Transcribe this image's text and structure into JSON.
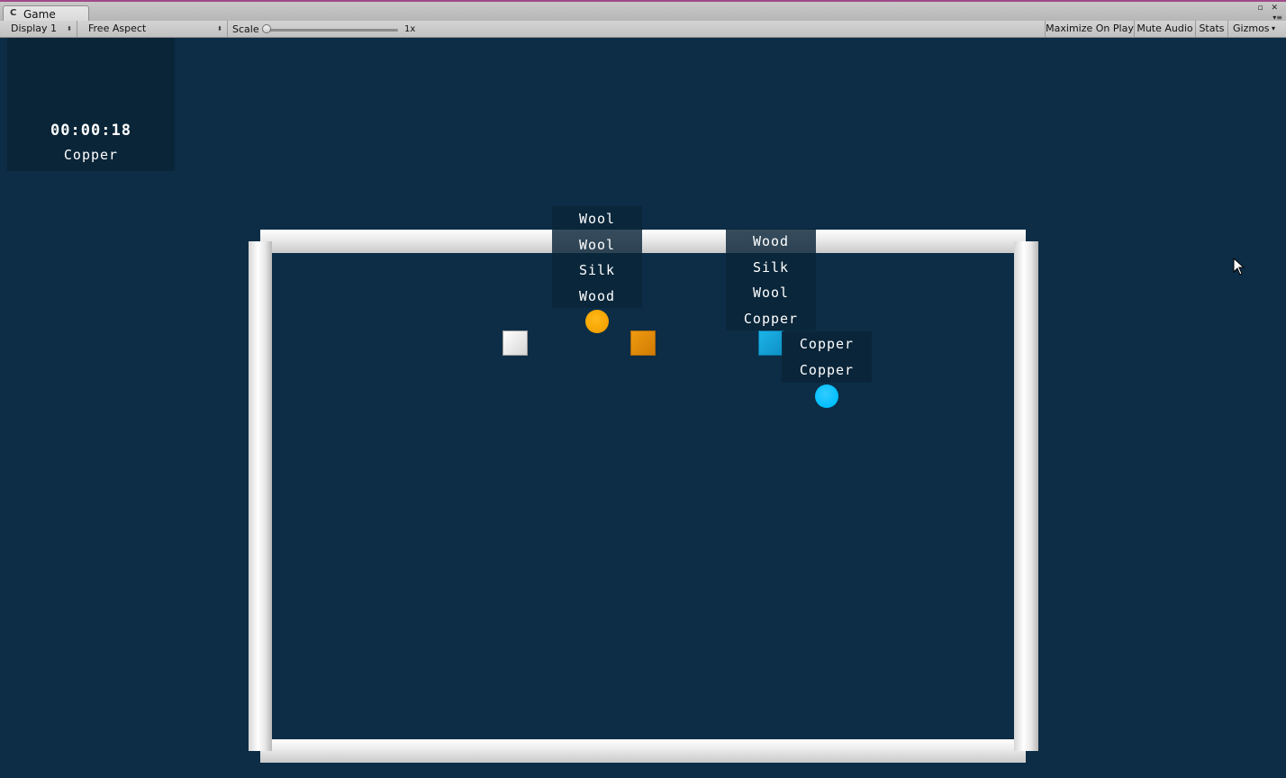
{
  "window": {
    "tab_title": "Game",
    "tab_icon": "C",
    "window_controls": "▫ ✕",
    "panel_menu": "▾≡"
  },
  "toolbar": {
    "display": "Display 1",
    "aspect": "Free Aspect",
    "scale_label": "Scale",
    "scale_value": "1x",
    "scale_level": 0,
    "maximize": "Maximize On Play",
    "mute": "Mute Audio",
    "stats": "Stats",
    "gizmos": "Gizmos",
    "dropdown_arrow": "⬍",
    "gizmos_arrow": "▾"
  },
  "hud": {
    "timer": "00:00:18",
    "target_item": "Copper"
  },
  "stacks": {
    "left": [
      "Wool",
      "Wool",
      "Silk",
      "Wood"
    ],
    "middle": [
      "Wood",
      "Silk",
      "Wool",
      "Copper"
    ],
    "right": [
      "Copper",
      "Copper"
    ]
  },
  "colors": {
    "background": "#0d2d46",
    "orange_ball": "#f5a300",
    "orange_box": "#e08a05",
    "white_box": "#e4e4e4",
    "cyan_box": "#129ed3",
    "cyan_ball": "#00bfff",
    "wall": "#ececec"
  }
}
